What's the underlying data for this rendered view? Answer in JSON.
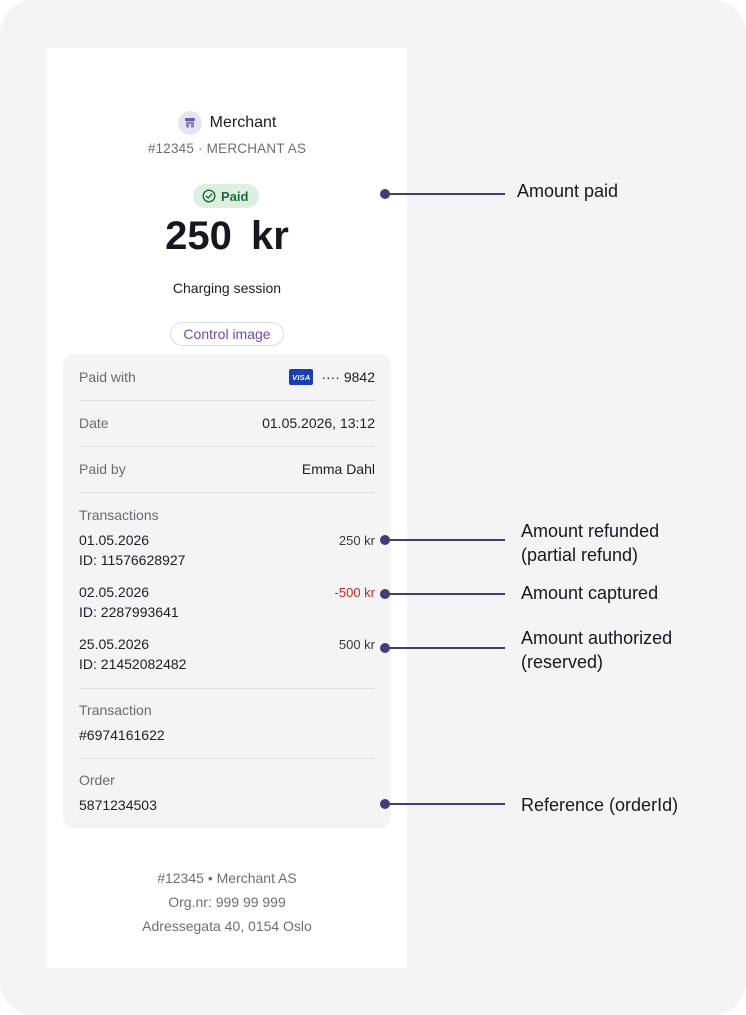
{
  "merchant": {
    "name": "Merchant",
    "subtitle": "#12345 · MERCHANT AS"
  },
  "status": {
    "label": "Paid",
    "color": "#1f6b36"
  },
  "payment": {
    "amount": "250  kr",
    "description": "Charging session",
    "control_button": "Control image"
  },
  "details": {
    "paid_with": {
      "label": "Paid with",
      "card_brand": "VISA",
      "card_number": "···· 9842"
    },
    "date": {
      "label": "Date",
      "value": "01.05.2026, 13:12"
    },
    "paid_by": {
      "label": "Paid by",
      "value": "Emma Dahl"
    },
    "transactions": {
      "label": "Transactions",
      "items": [
        {
          "date": "01.05.2026",
          "id": "ID: 11576628927",
          "amount": "250 kr"
        },
        {
          "date": "02.05.2026",
          "id": "ID: 2287993641",
          "amount": "-500 kr"
        },
        {
          "date": "25.05.2026",
          "id": "ID: 21452082482",
          "amount": "500 kr"
        }
      ]
    },
    "transaction": {
      "label": "Transaction",
      "value": "#6974161622"
    },
    "order": {
      "label": "Order",
      "value": "5871234503"
    }
  },
  "footer": {
    "line1": "#12345 • Merchant AS",
    "line2": "Org.nr: 999 99 999",
    "line3": "Adressegata 40, 0154 Oslo"
  },
  "annotations": {
    "amount_paid": "Amount paid",
    "amount_refunded_1": "Amount refunded",
    "amount_refunded_2": "(partial refund)",
    "amount_captured": "Amount captured",
    "amount_authorized_1": "Amount authorized",
    "amount_authorized_2": "(reserved)",
    "reference": "Reference (orderId)"
  },
  "colors": {
    "background": "#f4f4f5",
    "accent": "#6b4bb0",
    "annotation": "#463a78",
    "negative": "#c9261f",
    "visa": "#1a3fb4"
  }
}
